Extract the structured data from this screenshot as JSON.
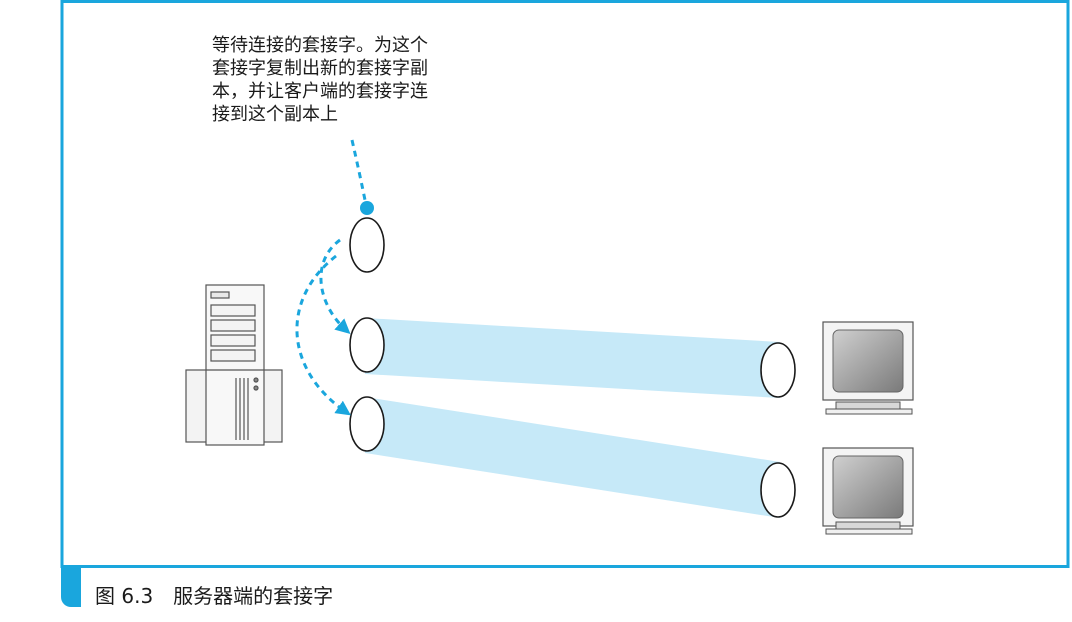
{
  "annotation": {
    "lines": [
      "等待连接的套接字。为这个",
      "套接字复制出新的套接字副",
      "本，并让客户端的套接字连",
      "接到这个副本上"
    ]
  },
  "caption": "图 6.3　服务器端的套接字",
  "colors": {
    "accent": "#1aa6dd",
    "pipe": "#c6e9f8",
    "stroke": "#1a1a1a"
  },
  "icons": [
    "server-icon",
    "client-computer-icon",
    "socket-icon"
  ]
}
